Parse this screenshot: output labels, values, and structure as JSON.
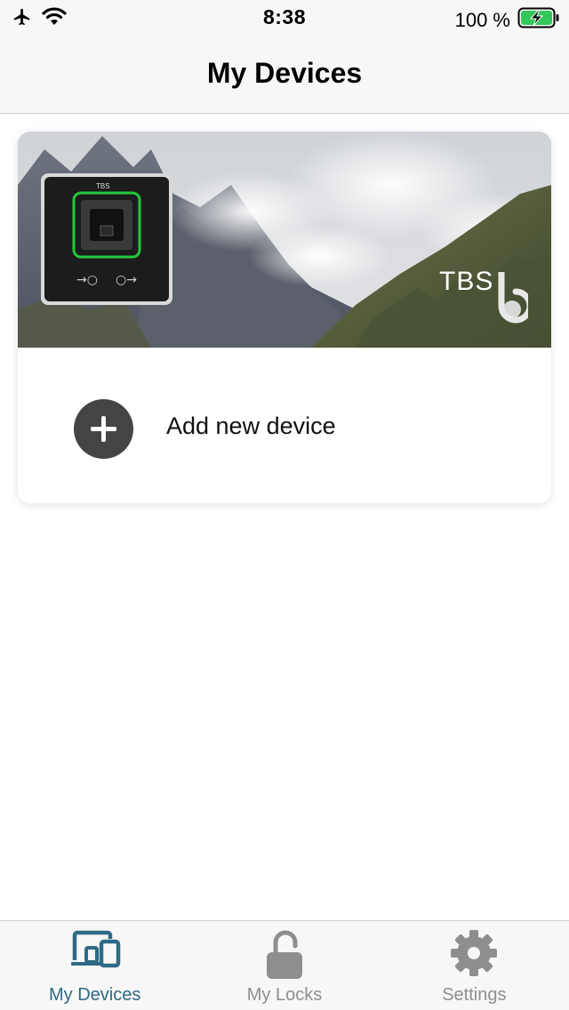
{
  "status_bar": {
    "time": "8:38",
    "battery_percent": "100 %",
    "icons": [
      "airplane-icon",
      "wifi-icon",
      "battery-charging-icon"
    ]
  },
  "header": {
    "title": "My Devices"
  },
  "device_card": {
    "banner_logo_text": "TBS",
    "reader_brand_text": "TBS",
    "add_label": "Add new device",
    "add_icon": "plus-icon"
  },
  "tab_bar": {
    "tabs": [
      {
        "label": "My Devices",
        "icon": "devices-icon",
        "active": true
      },
      {
        "label": "My Locks",
        "icon": "lock-icon",
        "active": false
      },
      {
        "label": "Settings",
        "icon": "gear-icon",
        "active": false
      }
    ]
  },
  "colors": {
    "accent": "#2e6a86",
    "inactive": "#8e8e8e",
    "bar_background": "#f7f7f7",
    "add_button": "#444444",
    "battery_green": "#34c759"
  }
}
